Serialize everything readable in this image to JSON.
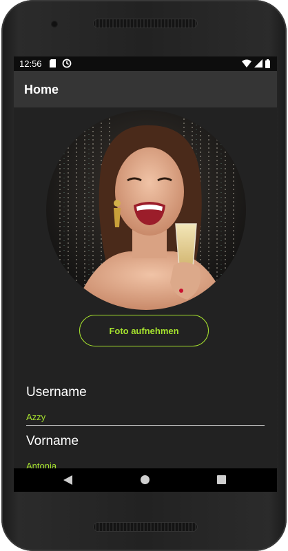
{
  "status_bar": {
    "time": "12:56",
    "icons": [
      "sd-card-icon",
      "sync-icon",
      "wifi-icon",
      "signal-icon",
      "battery-icon"
    ]
  },
  "app_bar": {
    "title": "Home"
  },
  "profile": {
    "photo_alt": "",
    "take_photo_label": "Foto aufnehmen"
  },
  "fields": [
    {
      "label": "Username",
      "value": "Azzy"
    },
    {
      "label": "Vorname",
      "value": "Antonia"
    }
  ],
  "nav_bar": {
    "icons": [
      "back-icon",
      "home-icon",
      "recents-icon"
    ]
  },
  "colors": {
    "accent": "#a6e22e",
    "background": "#222222",
    "app_bar": "#353535"
  }
}
